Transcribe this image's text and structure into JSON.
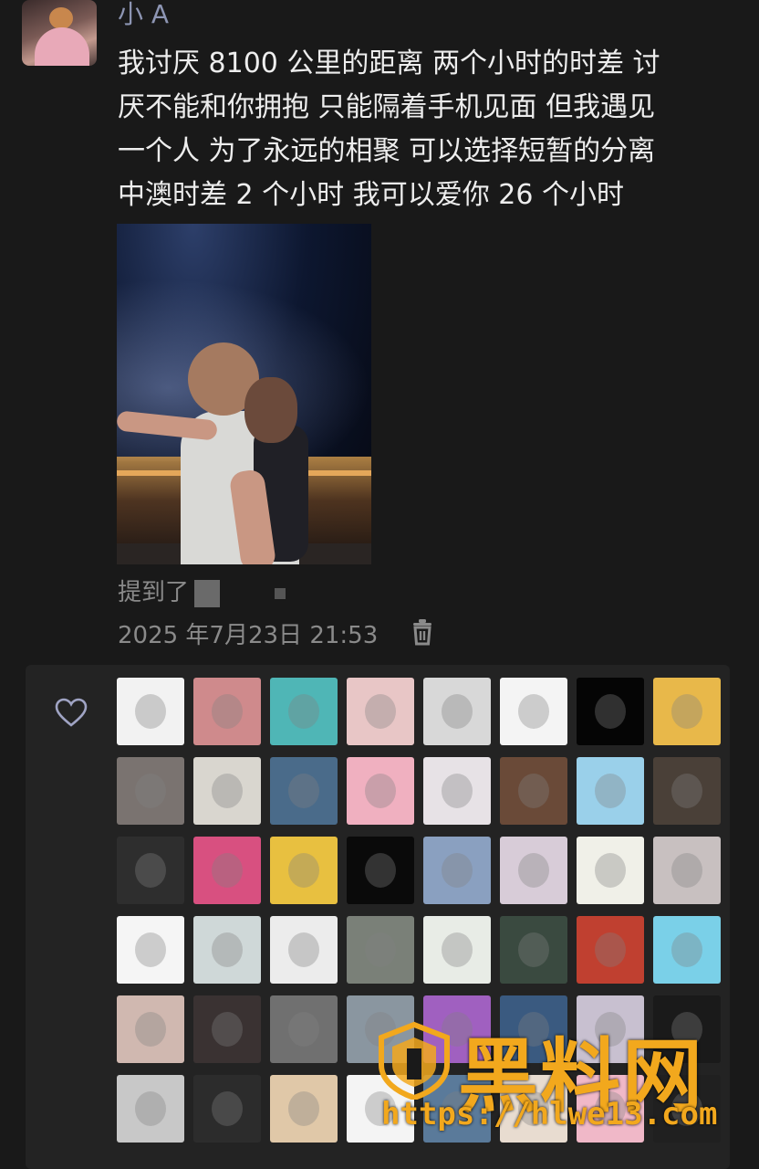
{
  "post": {
    "username": "小 A",
    "text": "我讨厌 8100 公里的距离 两个小时的时差 讨\n厌不能和你拥抱 只能隔着手机见面 但我遇见\n一个人 为了永远的相聚 可以选择短暂的分离\n中澳时差 2 个小时 我可以爱你 26 个小时",
    "mention_label": "提到了",
    "timestamp": "2025 年7月23日 21:53"
  },
  "icons": {
    "delete": "trash-icon",
    "like": "heart-icon"
  },
  "likers": [
    "#f2f2f2",
    "#cf8a8c",
    "#4fb6b6",
    "#e8c6c6",
    "#d8d8d8",
    "#f4f4f4",
    "#050505",
    "#e8b84a",
    "#7a7370",
    "#d9d6cf",
    "#4a6b8a",
    "#f0b0c0",
    "#e7e2e6",
    "#6a4a38",
    "#9ad0ea",
    "#4a4038",
    "#2e2e2e",
    "#d85080",
    "#e8c040",
    "#0a0a0a",
    "#8aa0c0",
    "#d8ccd8",
    "#f0f0e8",
    "#c8c0c0",
    "#f5f5f5",
    "#cfd8d8",
    "#ececec",
    "#7a8078",
    "#e8ece6",
    "#3a4a40",
    "#c04030",
    "#7ad0e8",
    "#d0b8b0",
    "#3a3232",
    "#707070",
    "#8a96a0",
    "#a060c0",
    "#3a5a80",
    "#c8c0d0",
    "#1a1a1a",
    "#c8c8c8",
    "#2c2c2c",
    "#e0c8a8",
    "#f4f4f4",
    "#5a7a9a",
    "#e8dcd0",
    "#f0b8c8",
    "#202020"
  ],
  "watermark": {
    "title": "黑料网",
    "url": "https://hlwe13.com"
  }
}
